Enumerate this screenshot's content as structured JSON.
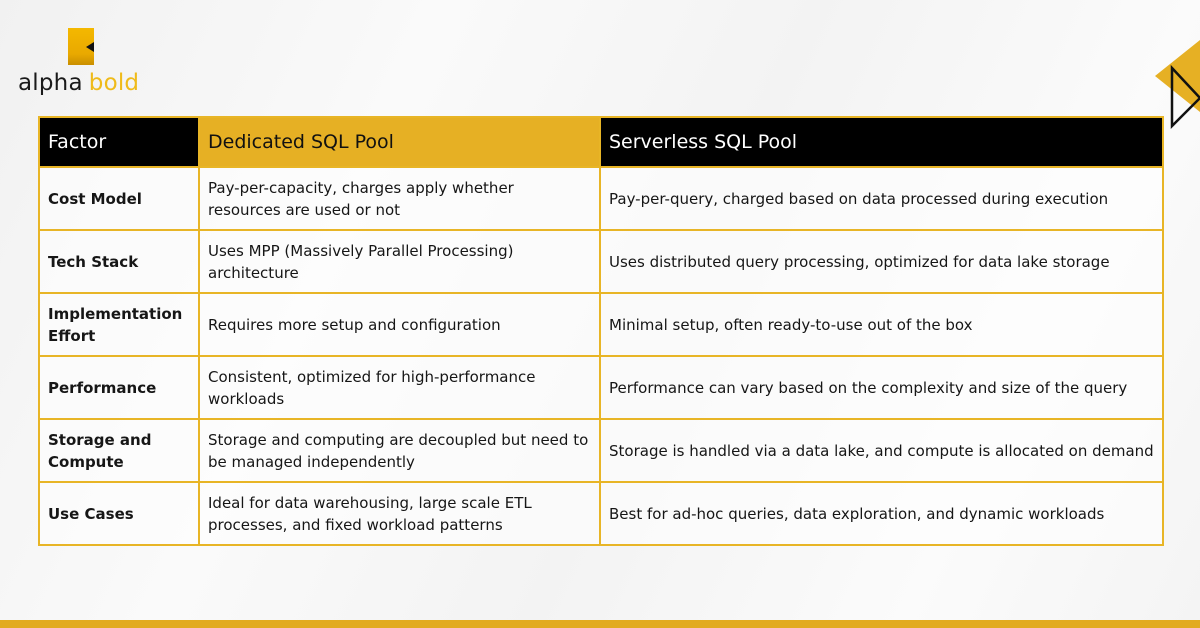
{
  "brand": {
    "name_part1": "alpha",
    "name_part2": "bold",
    "accent_color": "#e6b024"
  },
  "table": {
    "headers": [
      "Factor",
      "Dedicated SQL Pool",
      "Serverless SQL Pool"
    ],
    "rows": [
      {
        "factor": "Cost Model",
        "dedicated": "Pay-per-capacity, charges apply whether resources are used or not",
        "serverless": "Pay-per-query, charged based on data processed during execution"
      },
      {
        "factor": "Tech Stack",
        "dedicated": "Uses MPP (Massively Parallel Processing) architecture",
        "serverless": "Uses distributed query processing, optimized for data lake storage"
      },
      {
        "factor": "Implementation Effort",
        "dedicated": "Requires more setup and configuration",
        "serverless": "Minimal setup, often ready-to-use out of the box"
      },
      {
        "factor": "Performance",
        "dedicated": "Consistent, optimized for high-performance workloads",
        "serverless": "Performance can vary based on the complexity and size of the query"
      },
      {
        "factor": "Storage and Compute",
        "dedicated": "Storage and computing are decoupled but need to be managed independently",
        "serverless": "Storage is handled via a data lake, and compute is allocated on demand"
      },
      {
        "factor": "Use Cases",
        "dedicated": "Ideal for data warehousing, large scale ETL processes, and fixed workload patterns",
        "serverless": "Best for ad-hoc queries, data exploration, and dynamic workloads"
      }
    ]
  }
}
